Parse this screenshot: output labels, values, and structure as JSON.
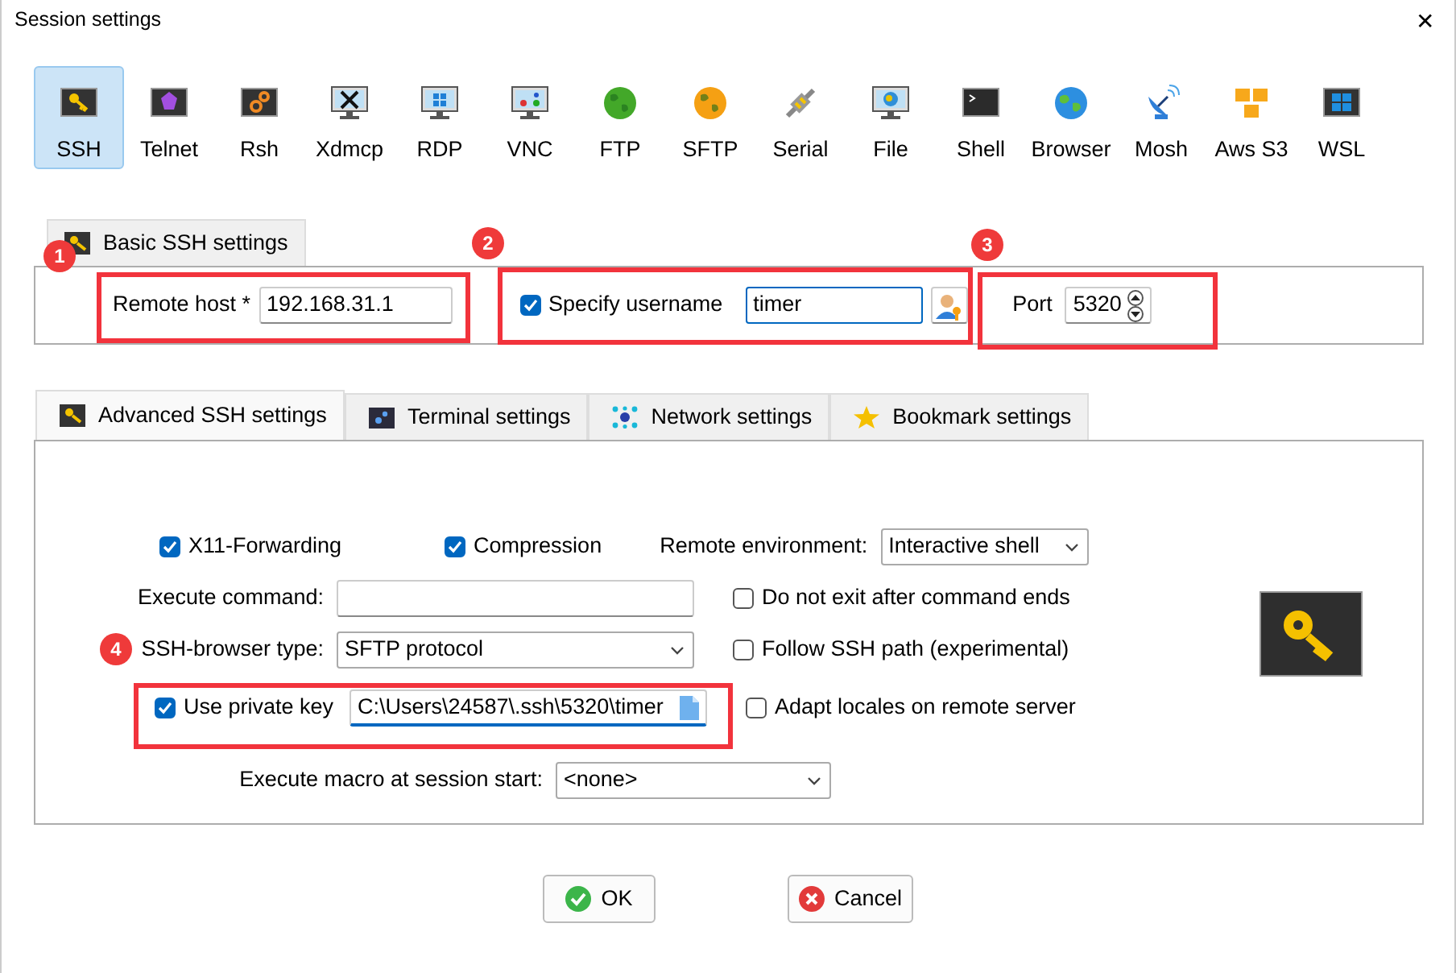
{
  "window": {
    "title": "Session settings",
    "close": "✕"
  },
  "session_types": [
    {
      "label": "SSH",
      "selected": true
    },
    {
      "label": "Telnet",
      "selected": false
    },
    {
      "label": "Rsh",
      "selected": false
    },
    {
      "label": "Xdmcp",
      "selected": false
    },
    {
      "label": "RDP",
      "selected": false
    },
    {
      "label": "VNC",
      "selected": false
    },
    {
      "label": "FTP",
      "selected": false
    },
    {
      "label": "SFTP",
      "selected": false
    },
    {
      "label": "Serial",
      "selected": false
    },
    {
      "label": "File",
      "selected": false
    },
    {
      "label": "Shell",
      "selected": false
    },
    {
      "label": "Browser",
      "selected": false
    },
    {
      "label": "Mosh",
      "selected": false
    },
    {
      "label": "Aws S3",
      "selected": false
    },
    {
      "label": "WSL",
      "selected": false
    }
  ],
  "basic_tab": {
    "label": "Basic SSH settings"
  },
  "basic": {
    "remote_host_label": "Remote host *",
    "remote_host": "192.168.31.1",
    "specify_username": {
      "label": "Specify username",
      "checked": true
    },
    "username": "timer",
    "port_label": "Port",
    "port": "5320"
  },
  "advanced_tabs": [
    {
      "label": "Advanced SSH settings",
      "selected": true
    },
    {
      "label": "Terminal settings",
      "selected": false
    },
    {
      "label": "Network settings",
      "selected": false
    },
    {
      "label": "Bookmark settings",
      "selected": false
    }
  ],
  "advanced": {
    "x11_forwarding": {
      "label": "X11-Forwarding",
      "checked": true
    },
    "compression": {
      "label": "Compression",
      "checked": true
    },
    "remote_environment_label": "Remote environment:",
    "remote_environment": "Interactive shell",
    "execute_command_label": "Execute command:",
    "do_not_exit": {
      "label": "Do not exit after command ends",
      "checked": false
    },
    "browser_type_label": "SSH-browser type:",
    "browser_type": "SFTP protocol",
    "follow_ssh_path": {
      "label": "Follow SSH path (experimental)",
      "checked": false
    },
    "use_private_key": {
      "label": "Use private key",
      "checked": true
    },
    "private_key_path": "C:\\Users\\24587\\.ssh\\5320\\timer",
    "adapt_locales": {
      "label": "Adapt locales on remote server",
      "checked": false
    },
    "macro_label": "Execute macro at session start:",
    "macro": "<none>"
  },
  "buttons": [
    {
      "label": "OK",
      "kind": "ok"
    },
    {
      "label": "Cancel",
      "kind": "cancel"
    }
  ],
  "annotations": [
    {
      "label": "1"
    },
    {
      "label": "2"
    },
    {
      "label": "3"
    },
    {
      "label": "4"
    }
  ]
}
